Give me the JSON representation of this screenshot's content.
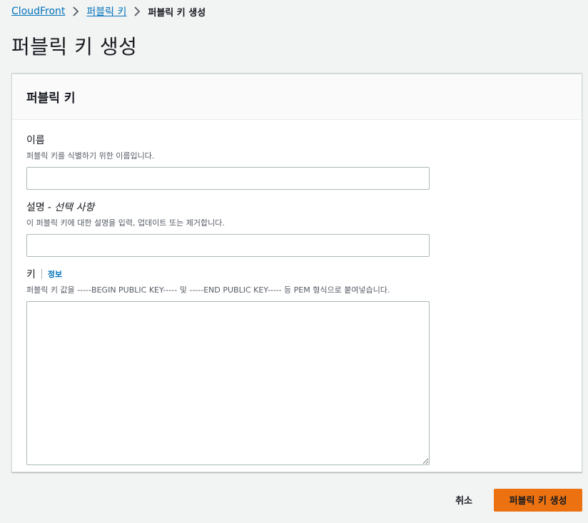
{
  "breadcrumb": {
    "root": "CloudFront",
    "parent": "퍼블릭 키",
    "current": "퍼블릭 키 생성"
  },
  "page": {
    "title": "퍼블릭 키 생성"
  },
  "panel": {
    "title": "퍼블릭 키",
    "name_field": {
      "label": "이름",
      "description": "퍼블릭 키를 식별하기 위한 이름입니다.",
      "value": ""
    },
    "description_field": {
      "label": "설명",
      "optional": "- 선택 사항",
      "description": "이 퍼블릭 키에 대한 설명을 입력, 업데이트 또는 제거합니다.",
      "value": ""
    },
    "key_field": {
      "label": "키",
      "info": "정보",
      "description": "퍼블릭 키 값을 -----BEGIN PUBLIC KEY----- 및 -----END PUBLIC KEY----- 등 PEM 형식으로 붙여넣습니다.",
      "value": ""
    }
  },
  "actions": {
    "cancel": "취소",
    "create": "퍼블릭 키 생성"
  },
  "colors": {
    "link": "#0073bb",
    "primary": "#ec7211",
    "background": "#f2f3f3"
  }
}
